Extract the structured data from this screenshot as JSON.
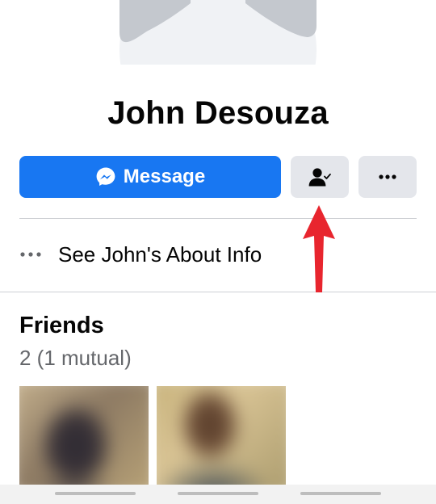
{
  "profile": {
    "name": "John Desouza"
  },
  "actions": {
    "message_label": "Message",
    "message_icon": "messenger-icon",
    "friend_icon": "friends-check-icon",
    "more_icon": "more-dots-icon",
    "accent_color": "#1877f2"
  },
  "about": {
    "label": "See John's About Info",
    "icon": "more-dots-icon"
  },
  "friends": {
    "title": "Friends",
    "count": "2 (1 mutual)"
  },
  "annotation": {
    "arrow_color": "#e8252e"
  }
}
